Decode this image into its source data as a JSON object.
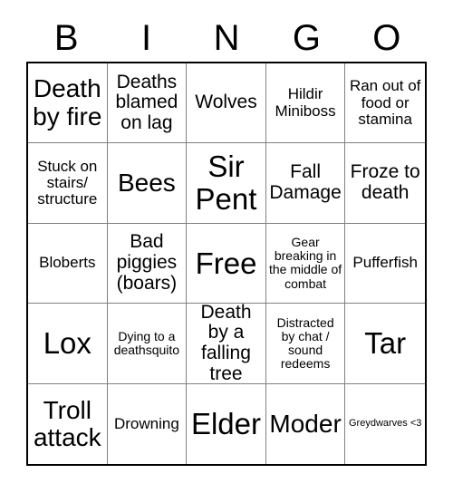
{
  "card": {
    "header_letters": [
      "B",
      "I",
      "N",
      "G",
      "O"
    ],
    "colors": {
      "background": "#ffffff",
      "text": "#000000",
      "outer_border": "#000000",
      "inner_gridline": "#808080"
    },
    "rows": [
      [
        {
          "text": "Death by fire",
          "size": "lg"
        },
        {
          "text": "Deaths blamed on lag",
          "size": "md"
        },
        {
          "text": "Wolves",
          "size": "md"
        },
        {
          "text": "Hildir Miniboss",
          "size": "sm"
        },
        {
          "text": "Ran out of food or stamina",
          "size": "sm"
        }
      ],
      [
        {
          "text": "Stuck on stairs/ structure",
          "size": "sm"
        },
        {
          "text": "Bees",
          "size": "lg"
        },
        {
          "text": "Sir Pent",
          "size": "xl"
        },
        {
          "text": "Fall Damage",
          "size": "md"
        },
        {
          "text": "Froze to death",
          "size": "md"
        }
      ],
      [
        {
          "text": "Bloberts",
          "size": "sm"
        },
        {
          "text": "Bad piggies (boars)",
          "size": "md"
        },
        {
          "text": "Free",
          "size": "xl"
        },
        {
          "text": "Gear breaking in the middle of combat",
          "size": "xs"
        },
        {
          "text": "Pufferfish",
          "size": "sm"
        }
      ],
      [
        {
          "text": "Lox",
          "size": "xl"
        },
        {
          "text": "Dying to a deathsquito",
          "size": "xs"
        },
        {
          "text": "Death by a falling tree",
          "size": "md"
        },
        {
          "text": "Distracted by chat / sound redeems",
          "size": "xs"
        },
        {
          "text": "Tar",
          "size": "xl"
        }
      ],
      [
        {
          "text": "Troll attack",
          "size": "lg"
        },
        {
          "text": "Drowning",
          "size": "sm"
        },
        {
          "text": "Elder",
          "size": "xl"
        },
        {
          "text": "Moder",
          "size": "lg"
        },
        {
          "text": "Greydwarves <3",
          "size": "xxs"
        }
      ]
    ]
  }
}
